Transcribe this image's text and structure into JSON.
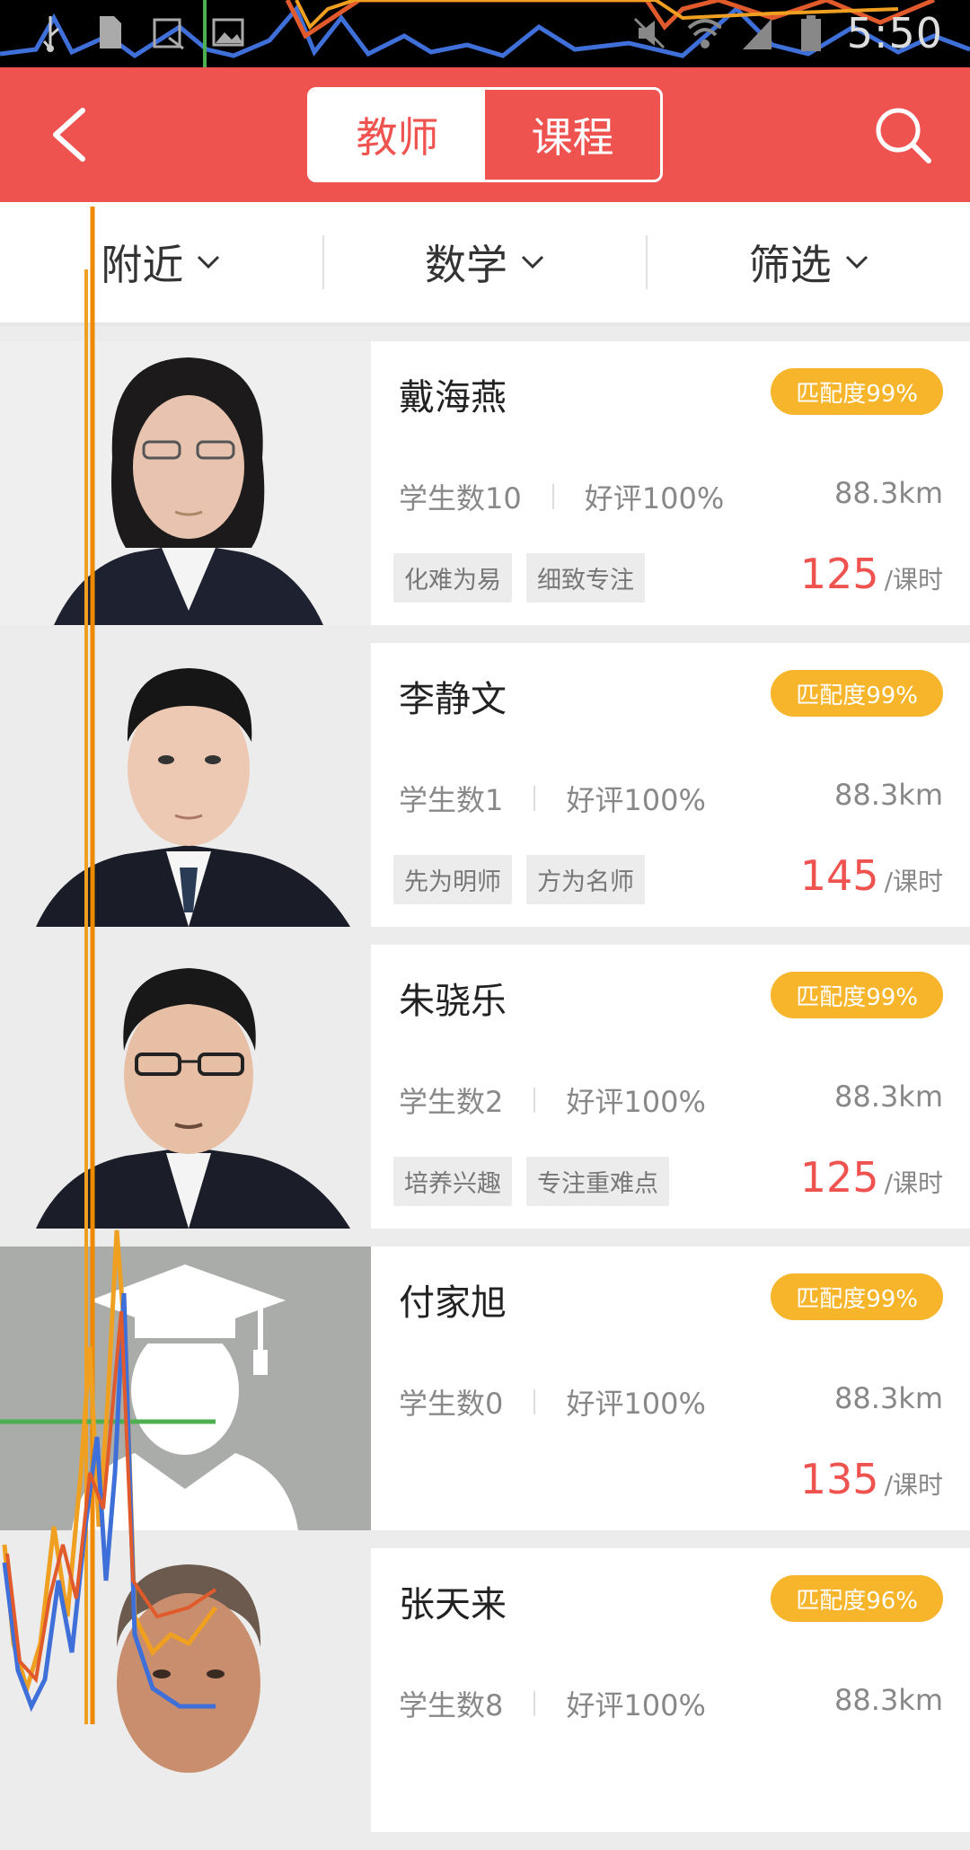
{
  "status_bar": {
    "time": "5:50",
    "left_icons": [
      "usb-icon",
      "sim-icon",
      "screenshot-icon",
      "image-icon"
    ],
    "right_icons": [
      "mute-icon",
      "wifi-icon",
      "signal-icon",
      "battery-icon"
    ]
  },
  "header": {
    "tabs": [
      {
        "label": "教师",
        "active": true
      },
      {
        "label": "课程",
        "active": false
      }
    ]
  },
  "filters": [
    {
      "label": "附近"
    },
    {
      "label": "数学"
    },
    {
      "label": "筛选"
    }
  ],
  "teachers": [
    {
      "name": "戴海燕",
      "match": "匹配度99%",
      "students": "学生数10",
      "rating": "好评100%",
      "distance": "88.3km",
      "tags": [
        "化难为易",
        "细致专注"
      ],
      "price": "125",
      "unit": "/课时"
    },
    {
      "name": "李静文",
      "match": "匹配度99%",
      "students": "学生数1",
      "rating": "好评100%",
      "distance": "88.3km",
      "tags": [
        "先为明师",
        "方为名师"
      ],
      "price": "145",
      "unit": "/课时"
    },
    {
      "name": "朱骁乐",
      "match": "匹配度99%",
      "students": "学生数2",
      "rating": "好评100%",
      "distance": "88.3km",
      "tags": [
        "培养兴趣",
        "专注重难点"
      ],
      "price": "125",
      "unit": "/课时"
    },
    {
      "name": "付家旭",
      "match": "匹配度99%",
      "students": "学生数0",
      "rating": "好评100%",
      "distance": "88.3km",
      "tags": [],
      "price": "135",
      "unit": "/课时"
    },
    {
      "name": "张天来",
      "match": "匹配度96%",
      "students": "学生数8",
      "rating": "好评100%",
      "distance": "88.3km",
      "tags": [],
      "price": "",
      "unit": ""
    }
  ]
}
